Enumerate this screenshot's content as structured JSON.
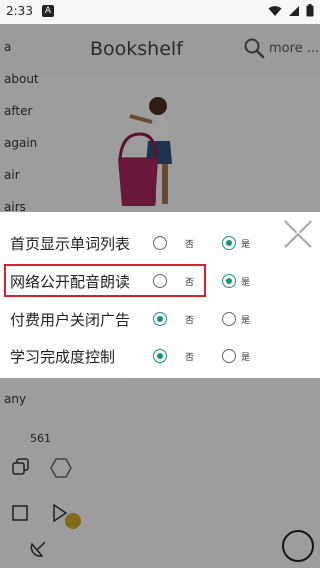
{
  "status_bar": {
    "time": "2:33",
    "badge": "A"
  },
  "header": {
    "title": "Bookshelf",
    "more_label": "more ..."
  },
  "word_list": [
    "a",
    "about",
    "after",
    "again",
    "air",
    "airs"
  ],
  "below_words": [
    "any"
  ],
  "count": "561",
  "dialog": {
    "options": [
      {
        "label": "首页显示单词列表",
        "selected": "yes"
      },
      {
        "label": "网络公开配音朗读",
        "selected": "yes"
      },
      {
        "label": "付费用户关闭广告",
        "selected": "no"
      },
      {
        "label": "学习完成度控制",
        "selected": "no"
      }
    ],
    "no_label": "否",
    "yes_label": "是"
  },
  "colors": {
    "accent": "#16937f",
    "highlight": "#d7232a"
  },
  "icons": [
    "wifi-icon",
    "signal-icon",
    "battery-icon",
    "search-icon",
    "close-icon",
    "copy-icon",
    "square-icon",
    "play-icon",
    "record-button"
  ]
}
